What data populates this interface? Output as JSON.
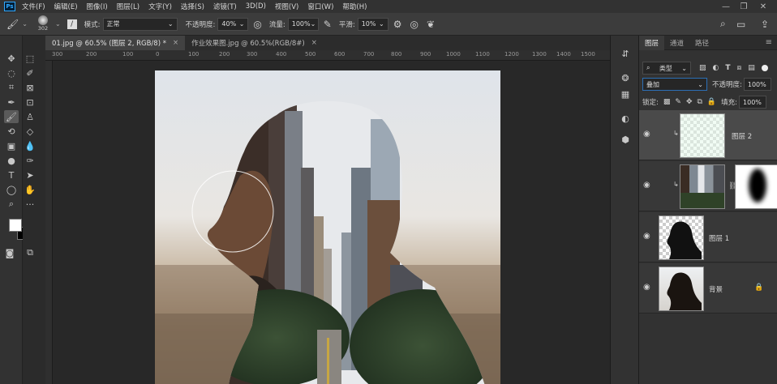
{
  "menubar": {
    "logo": "Ps",
    "items": [
      "文件(F)",
      "编辑(E)",
      "图像(I)",
      "图层(L)",
      "文字(Y)",
      "选择(S)",
      "滤镜(T)",
      "3D(D)",
      "视图(V)",
      "窗口(W)",
      "帮助(H)"
    ]
  },
  "options": {
    "brush_size": "302",
    "mode_label": "模式:",
    "mode_value": "正常",
    "opacity_label": "不透明度:",
    "opacity_value": "40%",
    "flow_label": "流量:",
    "flow_value": "100%",
    "smooth_label": "平滑:",
    "smooth_value": "10%"
  },
  "tabs": [
    {
      "label": "01.jpg @ 60.5% (图层 2, RGB/8) *",
      "close": "×"
    },
    {
      "label": "作业效果图.jpg @ 60.5%(RGB/8#)",
      "close": "×"
    }
  ],
  "ruler": {
    "ticks": [
      "300",
      "200",
      "100",
      "0",
      "100",
      "200",
      "300",
      "400",
      "500",
      "600",
      "700",
      "800",
      "900",
      "1000",
      "1100",
      "1200",
      "1300",
      "1400",
      "1500",
      "1600"
    ]
  },
  "layers_panel": {
    "tabs": [
      "图层",
      "通道",
      "路径"
    ],
    "filter_label": "类型",
    "blend_mode": "叠加",
    "opacity_label": "不透明度:",
    "opacity_value": "100%",
    "lock_label": "锁定:",
    "fill_label": "填充:",
    "fill_value": "100%",
    "layers": [
      {
        "name": "图层 2"
      },
      {
        "name": ""
      },
      {
        "name": "图层 1"
      },
      {
        "name": "背景"
      }
    ]
  },
  "colors": {
    "foreground": "#ffffff",
    "background": "#000000",
    "accent": "#31a8ff"
  }
}
